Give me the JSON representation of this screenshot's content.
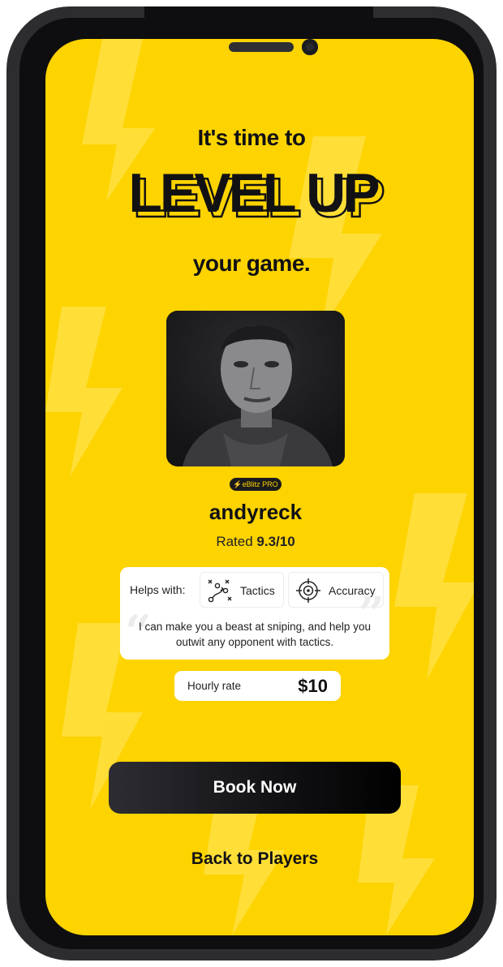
{
  "colors": {
    "accent": "#fdd300",
    "dark": "#111114",
    "card": "#ffffff",
    "device": "#2d2d2f"
  },
  "hero": {
    "line1": "It's time to",
    "line2": "LEVEL UP",
    "line3": "your game."
  },
  "player": {
    "badge_icon": "lightning-bolt-icon",
    "badge_label": "eBlitz PRO",
    "name": "andyreck",
    "rating_prefix": "Rated",
    "rating_value": "9.3/10"
  },
  "helps": {
    "label": "Helps with:",
    "skills": [
      {
        "label": "Tactics",
        "icon": "tactics-playbook-icon"
      },
      {
        "label": "Accuracy",
        "icon": "crosshair-target-icon"
      }
    ],
    "quote": "I can make you a beast at sniping, and help you outwit any opponent with tactics."
  },
  "rate": {
    "label": "Hourly rate",
    "value": "$10"
  },
  "actions": {
    "book_label": "Book Now",
    "back_label": "Back to Players"
  }
}
